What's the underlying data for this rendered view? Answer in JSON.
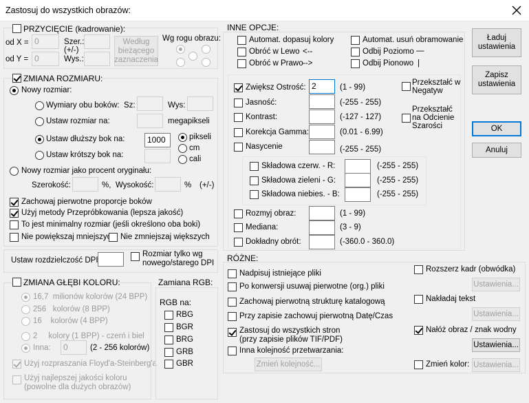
{
  "window": {
    "title": "Zastosuj do wszystkich obrazów:",
    "close_glyph": "✕"
  },
  "crop": {
    "label": "PRZYCIĘCIE",
    "hint": "(kadrowanie):",
    "x_label": "od X =",
    "y_label": "od Y =",
    "x_value": "0",
    "y_value": "0",
    "w_label": "Szer.:",
    "pm": "(+/-)",
    "h_label": "Wys.:",
    "button": "Według bieżącego zaznaczenia",
    "corner_label": "Wg rogu obrazu:"
  },
  "resize": {
    "label": "ZMIANA ROZMIARU:",
    "new_size": "Nowy rozmiar:",
    "both_sides": "Wymiary obu boków:",
    "w_label": "Sz:",
    "h_label": "Wys:",
    "megapixels": "Ustaw rozmiar na:",
    "mp_unit": "megapikseli",
    "longer": "Ustaw dłuższy bok na:",
    "longer_value": "1000",
    "shorter": "Ustaw krótszy bok na:",
    "unit_px": "pikseli",
    "unit_cm": "cm",
    "unit_in": "cali",
    "percent": "Nowy rozmiar jako procent oryginału:",
    "pw_label": "Szerokość:",
    "pct": "%,",
    "ph_label": "Wysokość:",
    "pct2": "%",
    "pm": "(+/-)",
    "keep_ratio": "Zachowaj pierwotne proporcje boków",
    "resample": "Użyj metody Przepróbkowania (lepsza jakość)",
    "min_size": "To jest minimalny rozmiar (jeśli określono oba boki)",
    "no_enlarge": "Nie powiększaj mniejszych",
    "no_shrink": "Nie zmniejszaj większych"
  },
  "dpi": {
    "label": "Ustaw rozdzielczość DPI:",
    "only_label": "Rozmiar tylko wg nowego/starego DPI"
  },
  "depth": {
    "label": "ZMIANA GŁĘBI KOLORU:",
    "o1": "16,7",
    "o1b": "milionów kolorów (24 BPP)",
    "o2": "256",
    "o2b": "kolorów (8 BPP)",
    "o3": "16",
    "o3b": "kolorów (4 BPP)",
    "o4": "2",
    "o4b": "kolory (1 BPP) - czerń i biel",
    "o5": "Inna:",
    "o5_value": "0",
    "o5_range": "(2 - 256 kolorów)",
    "floyd": "Użyj rozpraszania Floyd'a-Steinberg'a",
    "best": "Użyj najlepszej jakości koloru (powolne dla dużych obrazów)"
  },
  "rgb": {
    "label": "Zamiana RGB:",
    "sub": "RGB na:",
    "items": [
      "RBG",
      "BGR",
      "BRG",
      "GRB",
      "GBR"
    ]
  },
  "other": {
    "label": "INNE OPCJE:",
    "auto_colors": "Automat. dopasuj kolory",
    "auto_border": "Automat. usuń obramowanie",
    "rot_left": "Obróć w Lewo",
    "rot_left_arrow": "<--",
    "flip_h": "Odbij Poziomo",
    "flip_h_sym": "—",
    "rot_right": "Obróć w Prawo",
    "rot_right_arrow": "-->",
    "flip_v": "Odbij Pionowo",
    "flip_v_sym": "|",
    "sharpen": "Zwiększ Ostrość:",
    "sharpen_value": "2",
    "sharpen_range": "(1  -  99)",
    "brightness": "Jasność:",
    "brightness_range": "(-255  -  255)",
    "contrast": "Kontrast:",
    "contrast_range": "(-127  -  127)",
    "gamma": "Korekcja Gamma:",
    "gamma_range": "(0.01  -  6.99)",
    "saturation": "Nasycenie",
    "saturation_range": "(-255  -  255)",
    "red": "Składowa czerw.   - R:",
    "red_range": "(-255  -  255)",
    "green": "Składowa zieleni   - G:",
    "green_range": "(-255  -  255)",
    "blue": "Składowa niebies.  - B:",
    "blue_range": "(-255  -  255)",
    "blur": "Rozmyj obraz:",
    "blur_range": "(1  -  99)",
    "median": "Mediana:",
    "median_range": "(3  -  9)",
    "rotate": "Dokładny obrót:",
    "rotate_range": "(-360.0  -  360.0)",
    "negative": "Przekształć w Negatyw",
    "gray": "Przekształć na Odcienie Szarości"
  },
  "misc": {
    "label": "RÓŻNE:",
    "overwrite": "Nadpisuj istniejące pliki",
    "delete_orig": "Po konwersji usuwaj pierwotne (org.) pliki",
    "keep_dirs": "Zachowaj pierwotną strukturę katalogową",
    "keep_date": "Przy zapisie zachowuj pierwotną Datę/Czas",
    "all_pages": "Zastosuj do wszystkich stron (przy zapisie plików TIF/PDF)",
    "order": "Inna kolejność przetwarzania:",
    "order_button": "Zmień kolejność...",
    "canvas": "Rozszerz kadr (obwódka)",
    "settings": "Ustawienia...",
    "text": "Nakładaj tekst",
    "watermark": "Nałóż obraz / znak wodny",
    "color": "Zmień kolor:"
  },
  "buttons": {
    "load": "Ładuj ustawienia",
    "save": "Zapisz ustawienia",
    "ok": "OK",
    "cancel": "Anuluj"
  }
}
